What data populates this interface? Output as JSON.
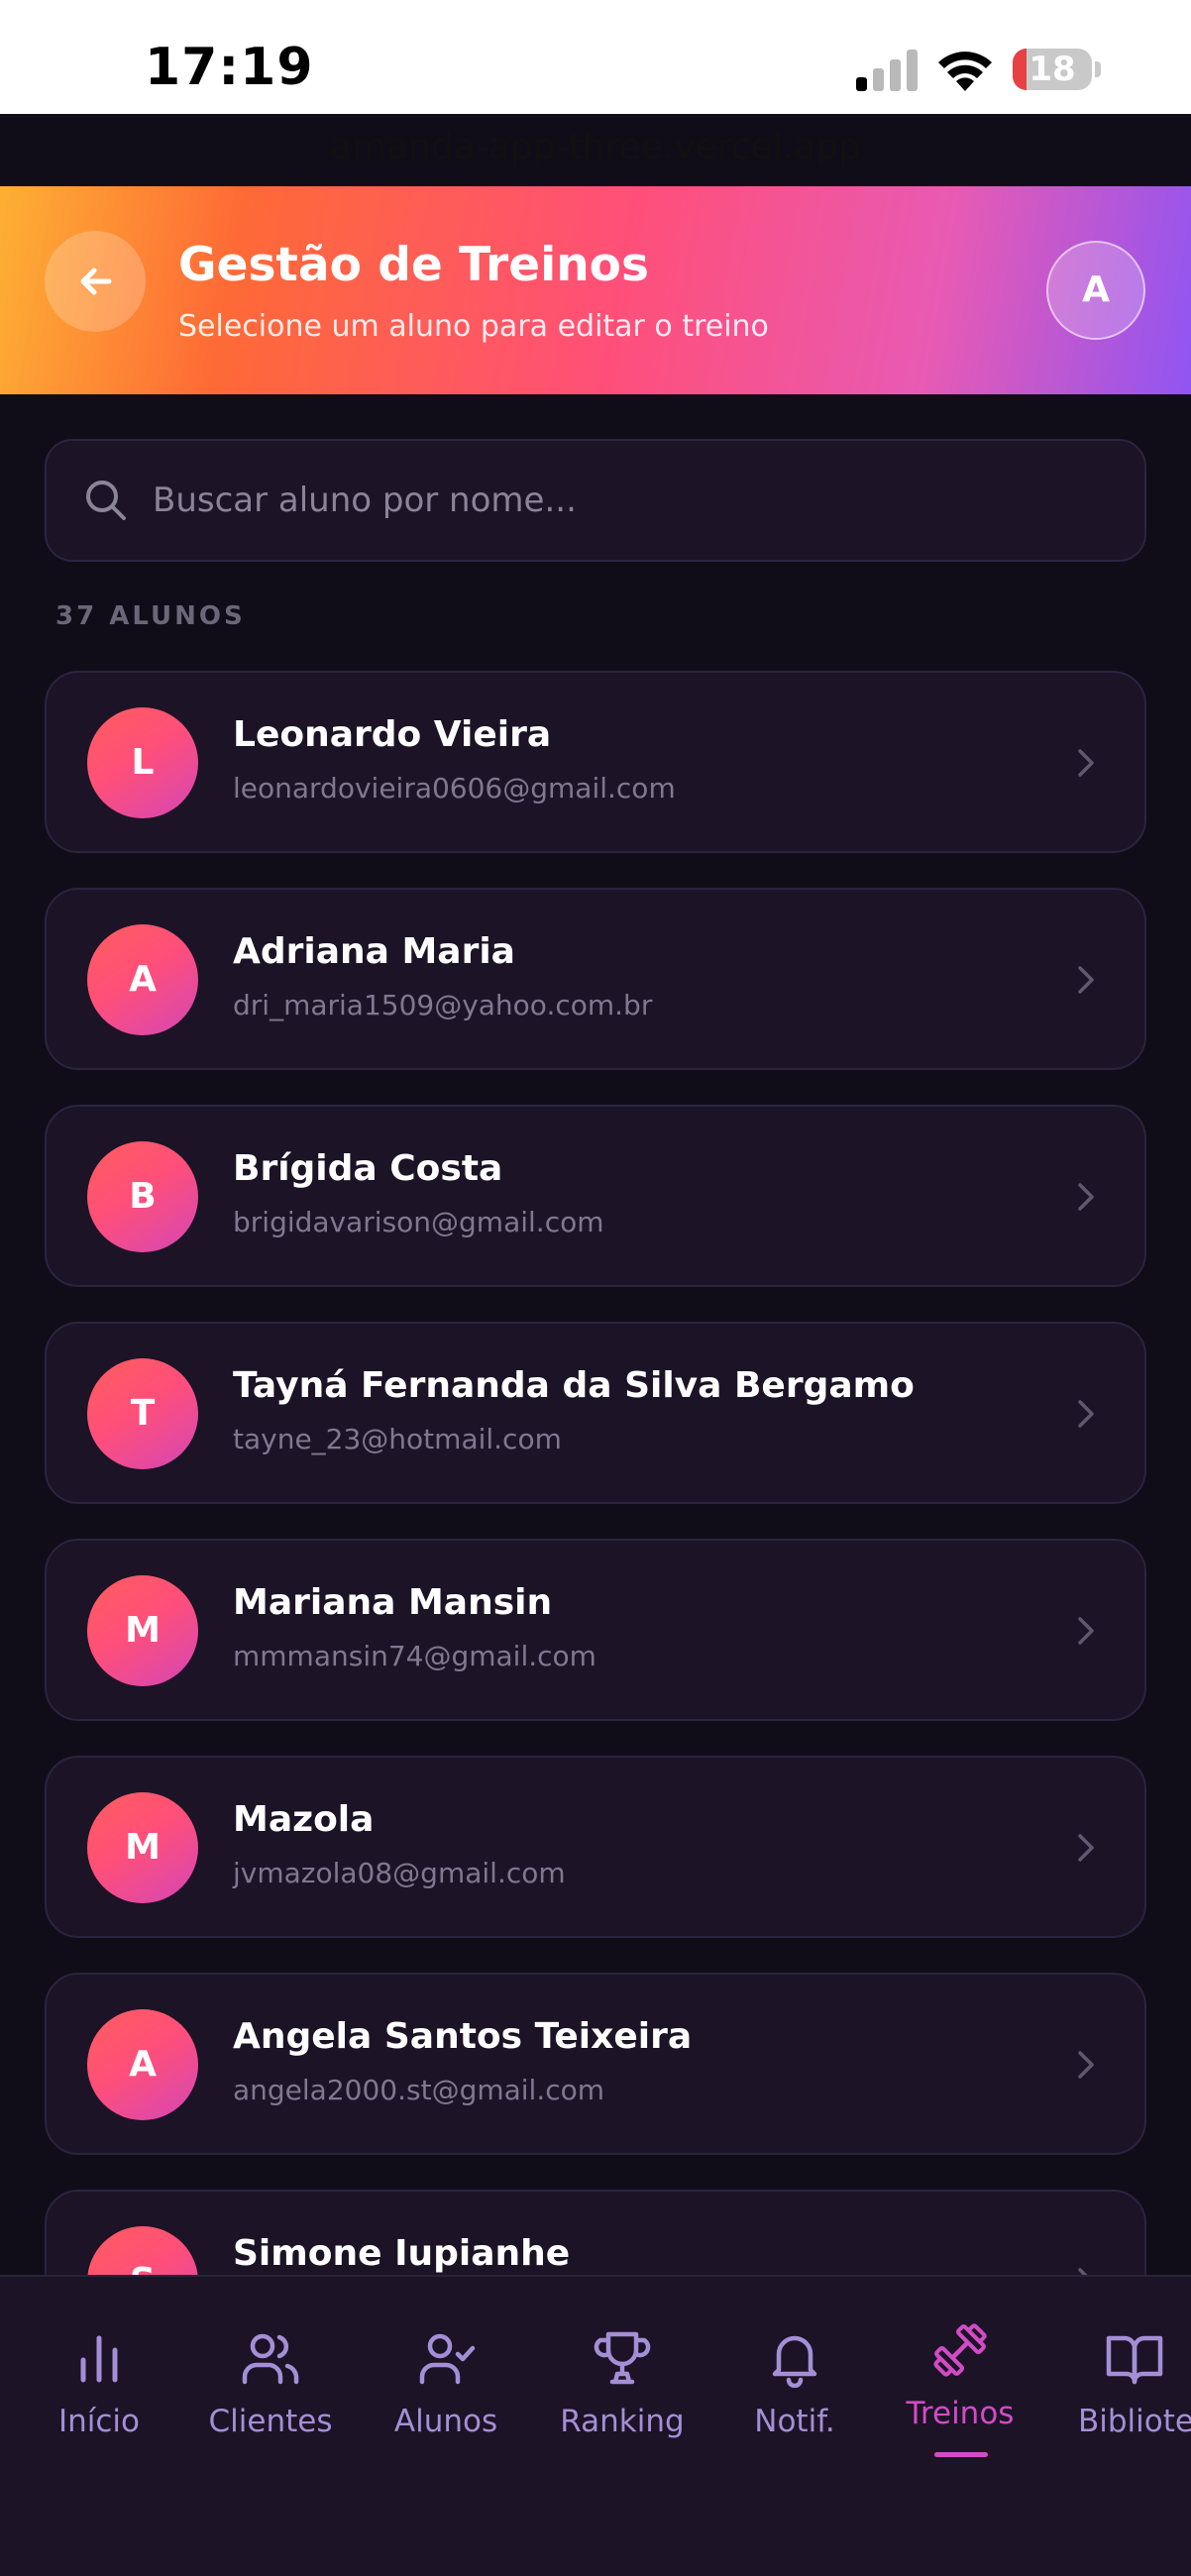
{
  "status_bar": {
    "time": "17:19",
    "battery": "18",
    "battery_level": 0.18
  },
  "browser": {
    "url": "amanda-app-three.vercel.app"
  },
  "header": {
    "title": "Gestão de Treinos",
    "subtitle": "Selecione um aluno para editar o treino",
    "avatar_initial": "A"
  },
  "search": {
    "placeholder": "Buscar aluno por nome..."
  },
  "count_label": "37 ALUNOS",
  "students": [
    {
      "initial": "L",
      "name": "Leonardo Vieira",
      "email": "leonardovieira0606@gmail.com"
    },
    {
      "initial": "A",
      "name": "Adriana Maria",
      "email": "dri_maria1509@yahoo.com.br"
    },
    {
      "initial": "B",
      "name": "Brígida Costa",
      "email": "brigidavarison@gmail.com"
    },
    {
      "initial": "T",
      "name": "Tayná Fernanda da Silva Bergamo",
      "email": "tayne_23@hotmail.com"
    },
    {
      "initial": "M",
      "name": "Mariana Mansin",
      "email": "mmmansin74@gmail.com"
    },
    {
      "initial": "M",
      "name": "Mazola",
      "email": "jvmazola08@gmail.com"
    },
    {
      "initial": "A",
      "name": "Angela Santos Teixeira",
      "email": "angela2000.st@gmail.com"
    },
    {
      "initial": "S",
      "name": "Simone Iupianhe",
      "email": ""
    }
  ],
  "nav": [
    {
      "label": "Início",
      "icon": "bar-chart-icon",
      "active": false
    },
    {
      "label": "Clientes",
      "icon": "users-icon",
      "active": false
    },
    {
      "label": "Alunos",
      "icon": "user-check-icon",
      "active": false
    },
    {
      "label": "Ranking",
      "icon": "trophy-icon",
      "active": false
    },
    {
      "label": "Notif.",
      "icon": "bell-icon",
      "active": false
    },
    {
      "label": "Treinos",
      "icon": "dumbbell-icon",
      "active": true
    },
    {
      "label": "Biblioteca",
      "icon": "book-icon",
      "active": false
    }
  ],
  "colors": {
    "accent": "#d24bc7",
    "nav_inactive": "#a38fd6",
    "background": "#100d19",
    "card": "#1c1326"
  }
}
